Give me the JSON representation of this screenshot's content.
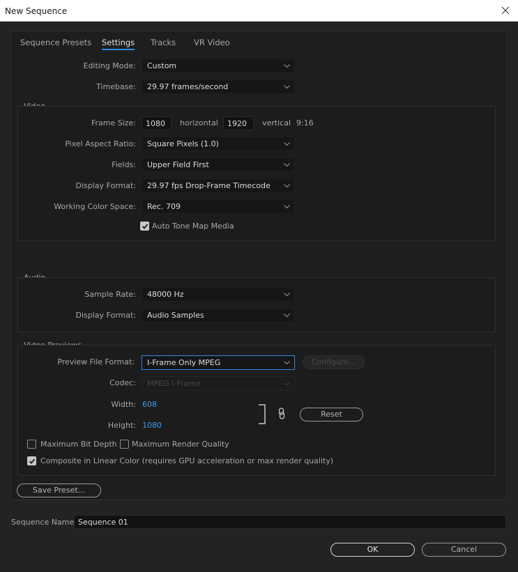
{
  "window": {
    "title": "New Sequence"
  },
  "tabs": [
    {
      "label": "Sequence Presets",
      "active": false
    },
    {
      "label": "Settings",
      "active": true
    },
    {
      "label": "Tracks",
      "active": false
    },
    {
      "label": "VR Video",
      "active": false
    }
  ],
  "settings": {
    "editing_mode": {
      "label": "Editing Mode:",
      "value": "Custom"
    },
    "timebase": {
      "label": "Timebase:",
      "value": "29.97  frames/second"
    }
  },
  "video": {
    "title": "Video",
    "frame_size": {
      "label": "Frame Size:",
      "horizontal": "1080",
      "horizontal_label": "horizontal",
      "vertical": "1920",
      "vertical_label": "vertical",
      "aspect": "9:16"
    },
    "pixel_aspect_ratio": {
      "label": "Pixel Aspect Ratio:",
      "value": "Square Pixels (1.0)"
    },
    "fields": {
      "label": "Fields:",
      "value": "Upper Field First"
    },
    "display_format": {
      "label": "Display Format:",
      "value": "29.97 fps Drop-Frame Timecode"
    },
    "working_color_space": {
      "label": "Working Color Space:",
      "value": "Rec. 709"
    },
    "auto_tone_map": {
      "label": "Auto Tone Map Media",
      "checked": true
    }
  },
  "audio": {
    "title": "Audio",
    "sample_rate": {
      "label": "Sample Rate:",
      "value": "48000 Hz"
    },
    "display_format": {
      "label": "Display Format:",
      "value": "Audio Samples"
    }
  },
  "previews": {
    "title": "Video Previews",
    "preview_file_format": {
      "label": "Preview File Format:",
      "value": "I-Frame Only MPEG"
    },
    "configure_label": "Configure...",
    "codec": {
      "label": "Codec:",
      "value": "MPEG I-Frame"
    },
    "width": {
      "label": "Width:",
      "value": "608"
    },
    "height": {
      "label": "Height:",
      "value": "1080"
    },
    "reset_label": "Reset",
    "max_bit_depth": {
      "label": "Maximum Bit Depth",
      "checked": false
    },
    "max_render_quality": {
      "label": "Maximum Render Quality",
      "checked": false
    },
    "composite_linear": {
      "label": "Composite in Linear Color (requires GPU acceleration or max render quality)",
      "checked": true
    }
  },
  "save_preset_label": "Save Preset...",
  "sequence_name": {
    "label": "Sequence Name:",
    "value": "Sequence 01"
  },
  "buttons": {
    "ok": "OK",
    "cancel": "Cancel"
  },
  "colors": {
    "accent": "#2d8ceb",
    "link_value": "#3b9bf0",
    "background": "#232323",
    "panel": "#1e1e1e"
  }
}
